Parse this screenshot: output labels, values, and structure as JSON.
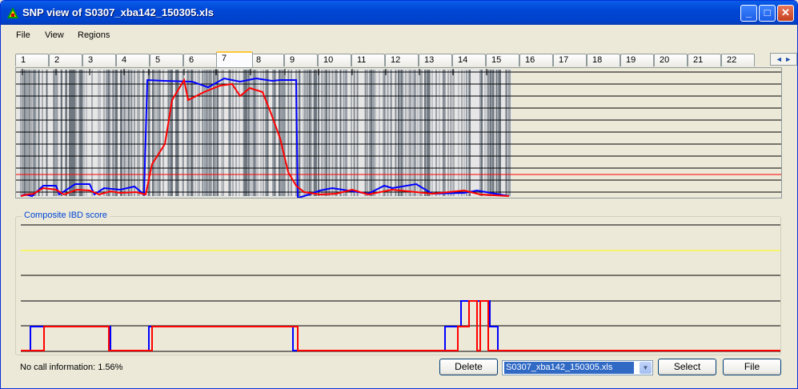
{
  "window": {
    "title": "SNP view of S0307_xba142_150305.xls",
    "controls": {
      "minimize": "_",
      "maximize": "□",
      "close": "✕"
    }
  },
  "menu": [
    "File",
    "View",
    "Regions"
  ],
  "tabs": [
    "1",
    "2",
    "3",
    "4",
    "5",
    "6",
    "7",
    "8",
    "9",
    "10",
    "11",
    "12",
    "13",
    "14",
    "15",
    "16",
    "17",
    "18",
    "19",
    "20",
    "21",
    "22"
  ],
  "active_tab": "7",
  "tab_scroll": "◄ ►",
  "ibd_panel": {
    "legend": "Composite IBD score"
  },
  "status": {
    "nocall": "No call information: 1.56%"
  },
  "buttons": {
    "delete": "Delete",
    "select": "Select",
    "file": "File"
  },
  "file_combo": {
    "value": "S0307_xba142_150305.xls"
  },
  "colors": {
    "series_blue": "#0000ff",
    "series_red": "#ff0000",
    "threshold_red": "#ff0000",
    "threshold_yellow": "#ffff00",
    "snp_lines": "#7a8088"
  }
}
